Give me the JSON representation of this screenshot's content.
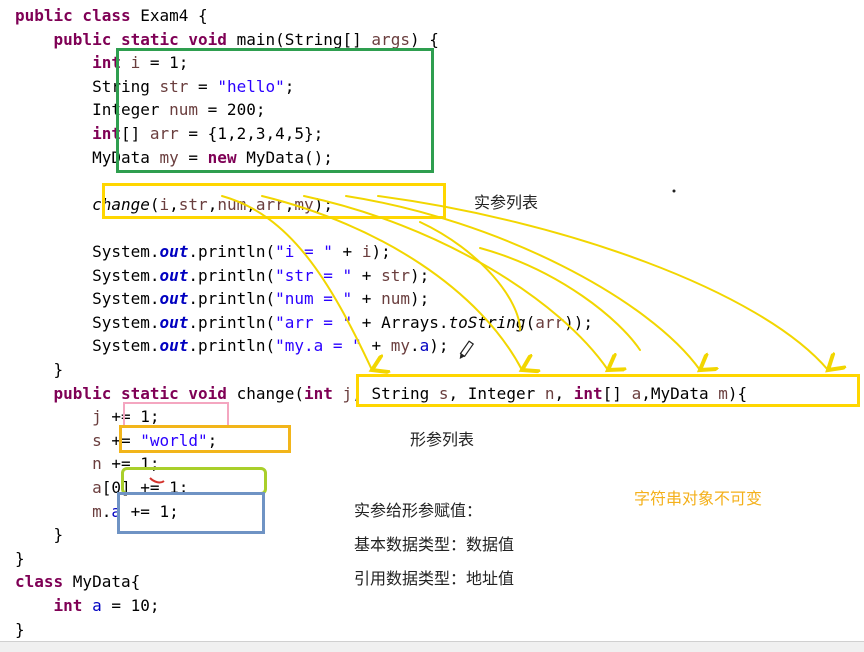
{
  "code_lines": [
    {
      "id": "l1",
      "tokens": [
        {
          "t": "public class ",
          "c": "kw"
        },
        {
          "t": "Exam4 {",
          "c": ""
        }
      ]
    },
    {
      "id": "l2",
      "tokens": [
        {
          "t": "    ",
          "c": ""
        },
        {
          "t": "public static void ",
          "c": "kw"
        },
        {
          "t": "main(String[] ",
          "c": ""
        },
        {
          "t": "args",
          "c": "var"
        },
        {
          "t": ") {",
          "c": ""
        }
      ]
    },
    {
      "id": "l3",
      "tokens": [
        {
          "t": "        ",
          "c": ""
        },
        {
          "t": "int ",
          "c": "kw"
        },
        {
          "t": "i",
          "c": "var"
        },
        {
          "t": " = 1;",
          "c": ""
        }
      ]
    },
    {
      "id": "l4",
      "tokens": [
        {
          "t": "        String ",
          "c": ""
        },
        {
          "t": "str",
          "c": "var"
        },
        {
          "t": " = ",
          "c": ""
        },
        {
          "t": "\"hello\"",
          "c": "str"
        },
        {
          "t": ";",
          "c": ""
        }
      ]
    },
    {
      "id": "l5",
      "tokens": [
        {
          "t": "        Integer ",
          "c": ""
        },
        {
          "t": "num",
          "c": "var"
        },
        {
          "t": " = 200;",
          "c": ""
        }
      ]
    },
    {
      "id": "l6",
      "tokens": [
        {
          "t": "        ",
          "c": ""
        },
        {
          "t": "int",
          "c": "kw"
        },
        {
          "t": "[] ",
          "c": ""
        },
        {
          "t": "arr",
          "c": "var"
        },
        {
          "t": " = {1,2,3,4,5};",
          "c": ""
        }
      ]
    },
    {
      "id": "l7",
      "tokens": [
        {
          "t": "        MyData ",
          "c": ""
        },
        {
          "t": "my",
          "c": "var"
        },
        {
          "t": " = ",
          "c": ""
        },
        {
          "t": "new ",
          "c": "kw"
        },
        {
          "t": "MyData();",
          "c": ""
        }
      ]
    },
    {
      "id": "l8",
      "tokens": []
    },
    {
      "id": "l9",
      "tokens": [
        {
          "t": "        ",
          "c": ""
        },
        {
          "t": "change",
          "c": "ital"
        },
        {
          "t": "(",
          "c": ""
        },
        {
          "t": "i",
          "c": "var"
        },
        {
          "t": ",",
          "c": ""
        },
        {
          "t": "str",
          "c": "var"
        },
        {
          "t": ",",
          "c": ""
        },
        {
          "t": "num",
          "c": "var"
        },
        {
          "t": ",",
          "c": ""
        },
        {
          "t": "arr",
          "c": "var"
        },
        {
          "t": ",",
          "c": ""
        },
        {
          "t": "my",
          "c": "var"
        },
        {
          "t": ");",
          "c": ""
        }
      ]
    },
    {
      "id": "l10",
      "tokens": []
    },
    {
      "id": "l11",
      "tokens": [
        {
          "t": "        System.",
          "c": ""
        },
        {
          "t": "out",
          "c": "fld-static"
        },
        {
          "t": ".println(",
          "c": ""
        },
        {
          "t": "\"i = \"",
          "c": "str"
        },
        {
          "t": " + ",
          "c": ""
        },
        {
          "t": "i",
          "c": "var"
        },
        {
          "t": ");",
          "c": ""
        }
      ]
    },
    {
      "id": "l12",
      "tokens": [
        {
          "t": "        System.",
          "c": ""
        },
        {
          "t": "out",
          "c": "fld-static"
        },
        {
          "t": ".println(",
          "c": ""
        },
        {
          "t": "\"str = \"",
          "c": "str"
        },
        {
          "t": " + ",
          "c": ""
        },
        {
          "t": "str",
          "c": "var"
        },
        {
          "t": ");",
          "c": ""
        }
      ]
    },
    {
      "id": "l13",
      "tokens": [
        {
          "t": "        System.",
          "c": ""
        },
        {
          "t": "out",
          "c": "fld-static"
        },
        {
          "t": ".println(",
          "c": ""
        },
        {
          "t": "\"num = \"",
          "c": "str"
        },
        {
          "t": " + ",
          "c": ""
        },
        {
          "t": "num",
          "c": "var"
        },
        {
          "t": ");",
          "c": ""
        }
      ]
    },
    {
      "id": "l14",
      "tokens": [
        {
          "t": "        System.",
          "c": ""
        },
        {
          "t": "out",
          "c": "fld-static"
        },
        {
          "t": ".println(",
          "c": ""
        },
        {
          "t": "\"arr = \"",
          "c": "str"
        },
        {
          "t": " + Arrays.",
          "c": ""
        },
        {
          "t": "toString",
          "c": "ital"
        },
        {
          "t": "(",
          "c": ""
        },
        {
          "t": "arr",
          "c": "var"
        },
        {
          "t": "));",
          "c": ""
        }
      ]
    },
    {
      "id": "l15",
      "tokens": [
        {
          "t": "        System.",
          "c": ""
        },
        {
          "t": "out",
          "c": "fld-static"
        },
        {
          "t": ".println(",
          "c": ""
        },
        {
          "t": "\"my.a = \"",
          "c": "str"
        },
        {
          "t": " + ",
          "c": ""
        },
        {
          "t": "my",
          "c": "var"
        },
        {
          "t": ".",
          "c": ""
        },
        {
          "t": "a",
          "c": "fld"
        },
        {
          "t": ");",
          "c": ""
        }
      ]
    },
    {
      "id": "l16",
      "tokens": [
        {
          "t": "    }",
          "c": ""
        }
      ]
    },
    {
      "id": "l17",
      "tokens": [
        {
          "t": "    ",
          "c": ""
        },
        {
          "t": "public static void ",
          "c": "kw"
        },
        {
          "t": "change(",
          "c": ""
        },
        {
          "t": "int ",
          "c": "kw"
        },
        {
          "t": "j",
          "c": "var"
        },
        {
          "t": ", String ",
          "c": ""
        },
        {
          "t": "s",
          "c": "var"
        },
        {
          "t": ", Integer ",
          "c": ""
        },
        {
          "t": "n",
          "c": "var"
        },
        {
          "t": ", ",
          "c": ""
        },
        {
          "t": "int",
          "c": "kw"
        },
        {
          "t": "[] ",
          "c": ""
        },
        {
          "t": "a",
          "c": "var"
        },
        {
          "t": ",MyData ",
          "c": ""
        },
        {
          "t": "m",
          "c": "var"
        },
        {
          "t": "){",
          "c": ""
        }
      ]
    },
    {
      "id": "l18",
      "tokens": [
        {
          "t": "        ",
          "c": ""
        },
        {
          "t": "j",
          "c": "var"
        },
        {
          "t": " += 1;",
          "c": ""
        }
      ]
    },
    {
      "id": "l19",
      "tokens": [
        {
          "t": "        ",
          "c": ""
        },
        {
          "t": "s",
          "c": "var"
        },
        {
          "t": " += ",
          "c": ""
        },
        {
          "t": "\"world\"",
          "c": "str"
        },
        {
          "t": ";",
          "c": ""
        }
      ]
    },
    {
      "id": "l20",
      "tokens": [
        {
          "t": "        ",
          "c": ""
        },
        {
          "t": "n",
          "c": "var"
        },
        {
          "t": " += 1;",
          "c": ""
        }
      ]
    },
    {
      "id": "l21",
      "tokens": [
        {
          "t": "        ",
          "c": ""
        },
        {
          "t": "a",
          "c": "var"
        },
        {
          "t": "[0] += 1;",
          "c": ""
        }
      ]
    },
    {
      "id": "l22",
      "tokens": [
        {
          "t": "        ",
          "c": ""
        },
        {
          "t": "m",
          "c": "var"
        },
        {
          "t": ".",
          "c": ""
        },
        {
          "t": "a",
          "c": "fld"
        },
        {
          "t": " += 1;",
          "c": ""
        }
      ]
    },
    {
      "id": "l23",
      "tokens": [
        {
          "t": "    }",
          "c": ""
        }
      ]
    },
    {
      "id": "l24",
      "tokens": [
        {
          "t": "}",
          "c": ""
        }
      ]
    },
    {
      "id": "l25",
      "tokens": [
        {
          "t": "class ",
          "c": "kw"
        },
        {
          "t": "MyData{",
          "c": ""
        }
      ]
    },
    {
      "id": "l26",
      "tokens": [
        {
          "t": "    ",
          "c": ""
        },
        {
          "t": "int ",
          "c": "kw"
        },
        {
          "t": "a",
          "c": "fld"
        },
        {
          "t": " = 10;",
          "c": ""
        }
      ]
    },
    {
      "id": "l27",
      "tokens": [
        {
          "t": "}",
          "c": ""
        }
      ]
    }
  ],
  "notes": {
    "actual_params": "实参列表",
    "formal_params": "形参列表",
    "assign_title": "实参给形参赋值：",
    "primitive_rule": "基本数据类型：数据值",
    "reference_rule": "引用数据类型：地址值",
    "string_immutable": "字符串对象不可变"
  },
  "colors": {
    "keyword": "#7f0055",
    "string": "#2a00ff",
    "local_var": "#6a3e3e",
    "field": "#0000c0",
    "box_locals": "#2e9e4f",
    "box_call": "#ffd600",
    "box_params": "#ffd600",
    "box_j": "#f4a6c0",
    "box_s": "#f2b51a",
    "box_a": "#a9cf2a",
    "box_m": "#6f93c4",
    "arrow": "#f2d600",
    "note_orange": "#f4b01a"
  }
}
